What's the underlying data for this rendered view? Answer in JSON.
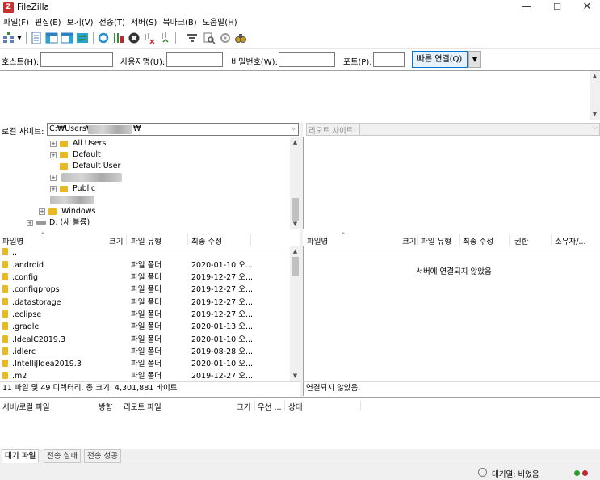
{
  "window": {
    "title": "FileZilla",
    "app_icon": "Z",
    "controls": {
      "min": "—",
      "max": "☐",
      "close": "✕"
    }
  },
  "menu": [
    "파일(F)",
    "편집(E)",
    "보기(V)",
    "전송(T)",
    "서버(S)",
    "북마크(B)",
    "도움말(H)"
  ],
  "quickconnect": {
    "host_label": "호스트(H):",
    "user_label": "사용자명(U):",
    "pass_label": "비밀번호(W):",
    "port_label": "포트(P):",
    "host_value": "",
    "user_value": "",
    "pass_value": "",
    "port_value": "",
    "connect_label": "빠른 연결(Q)",
    "dropdown_arrow": "▼"
  },
  "local_site": {
    "label": "로컬 사이트:",
    "path_prefix": "C:₩Users₩",
    "path_suffix": "₩"
  },
  "remote_site": {
    "label": "리모트 사이트:"
  },
  "local_tree": [
    {
      "label": "All Users"
    },
    {
      "label": "Default"
    },
    {
      "label": "Default User"
    },
    {
      "label": "Public"
    },
    {
      "label": "Windows"
    },
    {
      "label": "D: (새 볼륨)"
    }
  ],
  "local_columns": {
    "name": "파일명",
    "size": "크기",
    "type": "파일 유형",
    "modified": "최종 수정"
  },
  "remote_columns": {
    "name": "파일명",
    "size": "크기",
    "type": "파일 유형",
    "modified": "최종 수정",
    "perm": "권한",
    "owner": "소유자/..."
  },
  "local_files": [
    {
      "name": "..",
      "type": "",
      "modified": ""
    },
    {
      "name": ".android",
      "type": "파일 폴더",
      "modified": "2020-01-10 오..."
    },
    {
      "name": ".config",
      "type": "파일 폴더",
      "modified": "2019-12-27 오..."
    },
    {
      "name": ".configprops",
      "type": "파일 폴더",
      "modified": "2019-12-27 오..."
    },
    {
      "name": ".datastorage",
      "type": "파일 폴더",
      "modified": "2019-12-27 오..."
    },
    {
      "name": ".eclipse",
      "type": "파일 폴더",
      "modified": "2019-12-27 오..."
    },
    {
      "name": ".gradle",
      "type": "파일 폴더",
      "modified": "2020-01-13 오..."
    },
    {
      "name": ".IdealC2019.3",
      "type": "파일 폴더",
      "modified": "2020-01-10 오..."
    },
    {
      "name": ".idlerc",
      "type": "파일 폴더",
      "modified": "2019-08-28 오..."
    },
    {
      "name": ".IntelliJIdea2019.3",
      "type": "파일 폴더",
      "modified": "2020-01-10 오..."
    },
    {
      "name": ".m2",
      "type": "파일 폴더",
      "modified": "2019-12-27 오..."
    }
  ],
  "remote_empty_text": "서버에 연결되지 않았음",
  "local_status": "11 파일 및 49 디렉터리. 총 크기: 4,301,881 바이트",
  "remote_status": "연결되지 않았음.",
  "queue_columns": {
    "file": "서버/로컬 파일",
    "direction": "방향",
    "remote": "리모트 파일",
    "size": "크기",
    "priority": "우선 ...",
    "status": "상태"
  },
  "tabs": [
    "대기 파일",
    "전송 실패",
    "전송 성공"
  ],
  "statusbar": {
    "queue": "대기열: 비었음"
  },
  "colors": {
    "accent": "#0078d7",
    "folder": "#e8b923",
    "led_green": "#2e9e2e",
    "led_red": "#c0282b"
  }
}
